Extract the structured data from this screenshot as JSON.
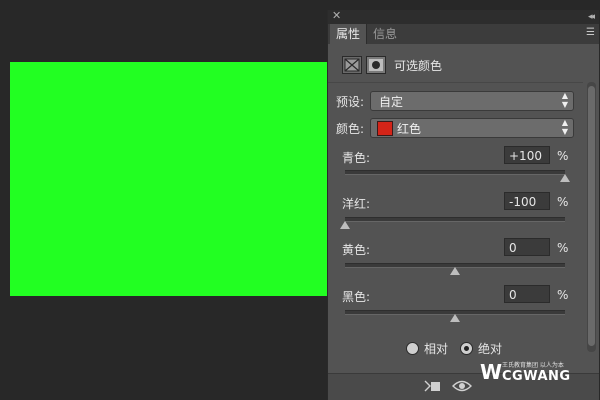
{
  "canvas": {
    "fill_color": "#22ff22"
  },
  "panel": {
    "tabs": [
      {
        "label": "属性",
        "active": true
      },
      {
        "label": "信息",
        "active": false
      }
    ],
    "adjustment_title": "可选颜色",
    "preset": {
      "label": "预设:",
      "value": "自定"
    },
    "color": {
      "label": "颜色:",
      "value": "红色",
      "swatch": "#d42418"
    },
    "sliders": [
      {
        "label": "青色:",
        "value": "+100",
        "unit": "%",
        "level": 1.0
      },
      {
        "label": "洋红:",
        "value": "-100",
        "unit": "%",
        "level": 0.0
      },
      {
        "label": "黄色:",
        "value": "0",
        "unit": "%",
        "level": 0.5
      },
      {
        "label": "黑色:",
        "value": "0",
        "unit": "%",
        "level": 0.5
      }
    ],
    "mode": {
      "options": [
        "相对",
        "绝对"
      ],
      "selected": "绝对"
    }
  },
  "icons": {
    "close": "✕",
    "collapse": "◂◂",
    "panel_menu": "☰",
    "adjustment_layer": "adjustment-layer-icon",
    "mask": "mask-icon",
    "clip": "clip-to-layer-icon",
    "visibility": "eye-icon"
  },
  "watermark": {
    "mark": "W",
    "name": "CGWANG",
    "tagline": "王氏教育集团 以人为本"
  }
}
